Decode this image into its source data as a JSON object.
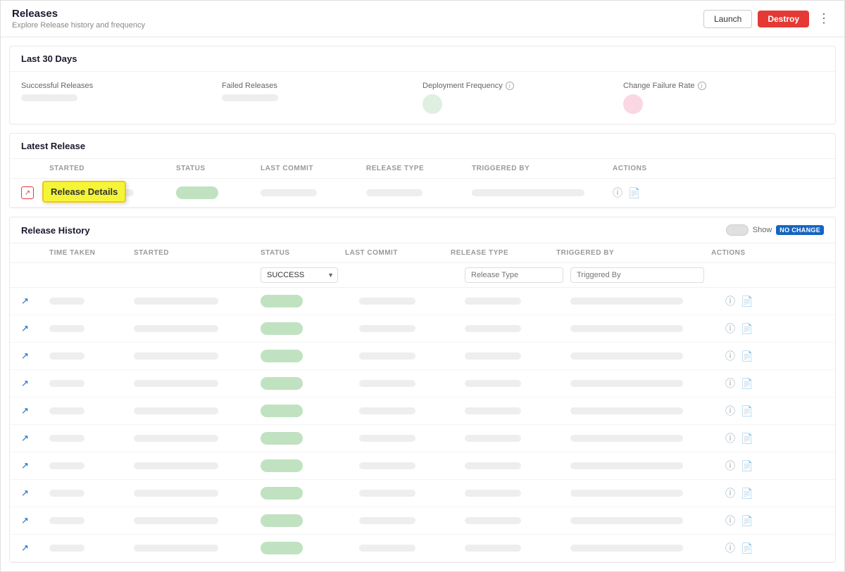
{
  "header": {
    "title": "Releases",
    "subtitle": "Explore Release history and frequency",
    "btn_launch": "Launch",
    "btn_destroy": "Destroy"
  },
  "last30days": {
    "section_title": "Last 30 Days",
    "stats": [
      {
        "label": "Successful Releases",
        "type": "pill"
      },
      {
        "label": "Failed Releases",
        "type": "pill"
      },
      {
        "label": "Deployment Frequency",
        "type": "circle",
        "has_info": true
      },
      {
        "label": "Change Failure Rate",
        "type": "circle_pink",
        "has_info": true
      }
    ]
  },
  "latest_release": {
    "section_title": "Latest Release",
    "columns": [
      "",
      "STARTED",
      "STATUS",
      "LAST COMMIT",
      "RELEASE TYPE",
      "TRIGGERED BY",
      "ACTIONS"
    ],
    "tooltip": "Release Details"
  },
  "release_history": {
    "section_title": "Release History",
    "show_label": "Show",
    "no_change_badge": "NO CHANGE",
    "columns": [
      "",
      "TIME TAKEN",
      "STARTED",
      "STATUS",
      "LAST COMMIT",
      "RELEASE TYPE",
      "TRIGGERED BY",
      "ACTIONS"
    ],
    "filter_status_default": "SUCCESS",
    "filter_release_type_placeholder": "Release Type",
    "filter_triggered_by_placeholder": "Triggered By",
    "row_count": 10
  }
}
